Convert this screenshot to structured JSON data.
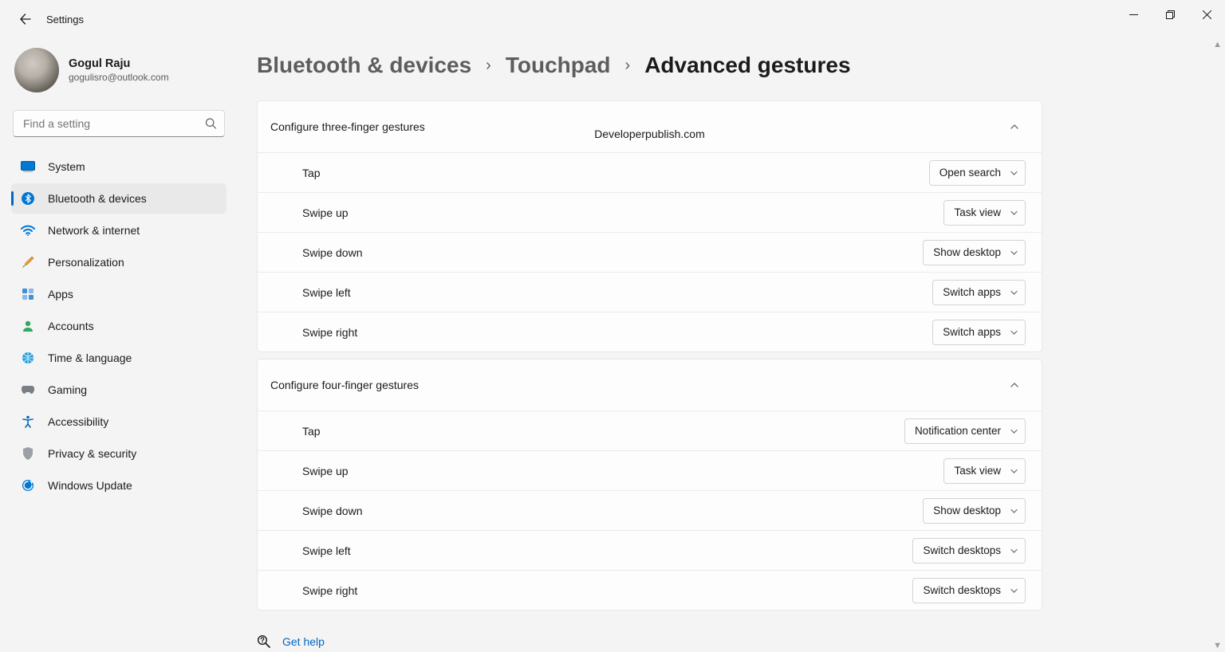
{
  "app_title": "Settings",
  "user": {
    "name": "Gogul Raju",
    "email": "gogulisro@outlook.com"
  },
  "search": {
    "placeholder": "Find a setting"
  },
  "sidebar": {
    "items": [
      {
        "label": "System"
      },
      {
        "label": "Bluetooth & devices"
      },
      {
        "label": "Network & internet"
      },
      {
        "label": "Personalization"
      },
      {
        "label": "Apps"
      },
      {
        "label": "Accounts"
      },
      {
        "label": "Time & language"
      },
      {
        "label": "Gaming"
      },
      {
        "label": "Accessibility"
      },
      {
        "label": "Privacy & security"
      },
      {
        "label": "Windows Update"
      }
    ]
  },
  "breadcrumb": {
    "root": "Bluetooth & devices",
    "mid": "Touchpad",
    "current": "Advanced gestures",
    "sep": "›"
  },
  "watermark": "Developerpublish.com",
  "sections": [
    {
      "title": "Configure three-finger gestures",
      "rows": [
        {
          "label": "Tap",
          "value": "Open search"
        },
        {
          "label": "Swipe up",
          "value": "Task view"
        },
        {
          "label": "Swipe down",
          "value": "Show desktop"
        },
        {
          "label": "Swipe left",
          "value": "Switch apps"
        },
        {
          "label": "Swipe right",
          "value": "Switch apps"
        }
      ]
    },
    {
      "title": "Configure four-finger gestures",
      "rows": [
        {
          "label": "Tap",
          "value": "Notification center"
        },
        {
          "label": "Swipe up",
          "value": "Task view"
        },
        {
          "label": "Swipe down",
          "value": "Show desktop"
        },
        {
          "label": "Swipe left",
          "value": "Switch desktops"
        },
        {
          "label": "Swipe right",
          "value": "Switch desktops"
        }
      ]
    }
  ],
  "help": {
    "label": "Get help"
  }
}
